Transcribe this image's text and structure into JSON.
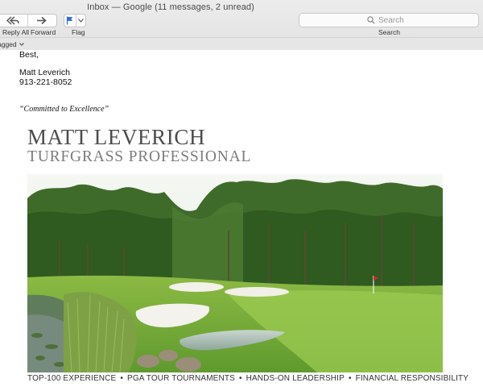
{
  "window": {
    "title": "Inbox — Google (11 messages, 2 unread)"
  },
  "toolbar": {
    "reply_all_label": "Reply All",
    "forward_label": "Forward",
    "flag_label": "Flag",
    "search_label": "Search",
    "search_placeholder": "Search",
    "flag_color": "#2d6fd8"
  },
  "favorites_bar": {
    "item_label": "agged"
  },
  "message": {
    "closing": "Best,",
    "sender_name": "Matt Leverich",
    "sender_phone": "913-221-8052",
    "motto": "“Committed to Excellence”"
  },
  "signature": {
    "name": "MATT LEVERICH",
    "title": "TURFGRASS PROFESSIONAL",
    "photo_subject": "golf course green with sand bunkers, pond and tall trees",
    "credentials": [
      "TOP-100 EXPERIENCE",
      "PGA TOUR TOURNAMENTS",
      "HANDS-ON LEADERSHIP",
      "FINANCIAL RESPONSIBILITY"
    ],
    "separator": "•"
  }
}
